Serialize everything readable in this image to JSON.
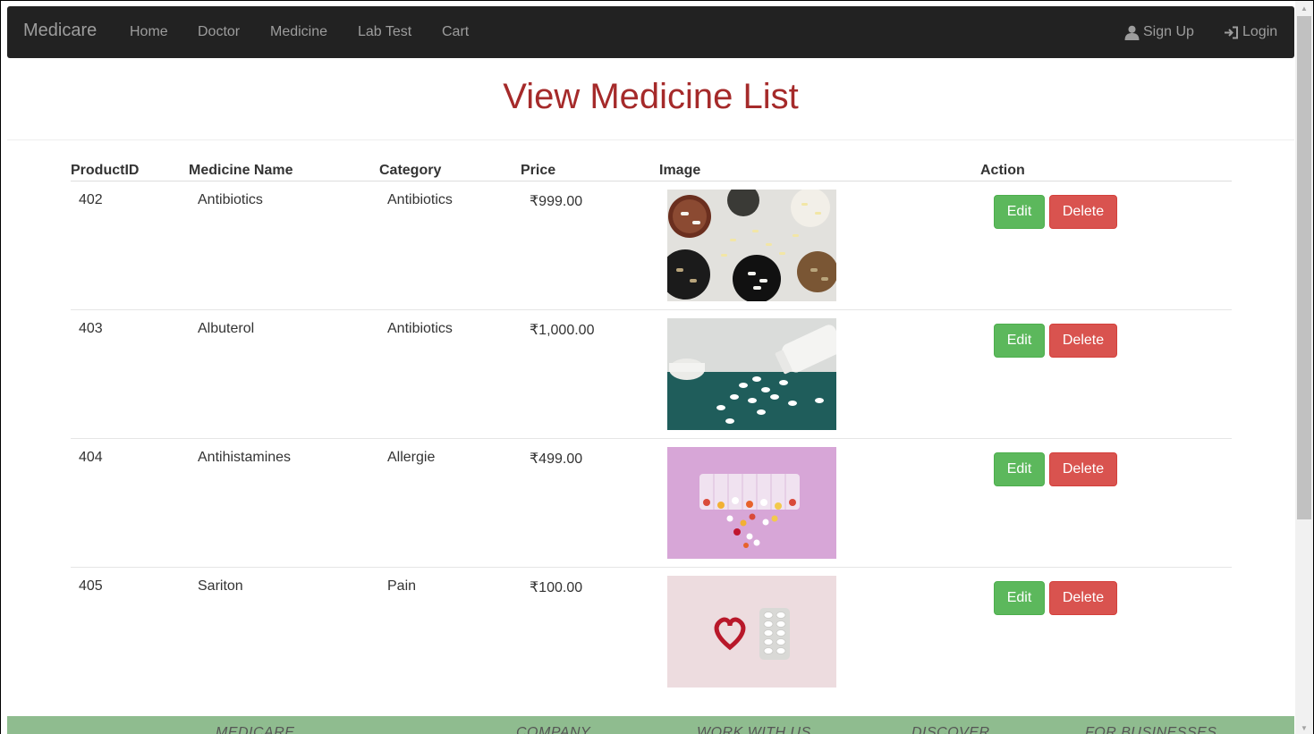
{
  "navbar": {
    "brand": "Medicare",
    "links": [
      "Home",
      "Doctor",
      "Medicine",
      "Lab Test",
      "Cart"
    ],
    "signup": "Sign Up",
    "login": "Login"
  },
  "page": {
    "title": "View Medicine List"
  },
  "table": {
    "headers": [
      "ProductID",
      "Medicine Name",
      "Category",
      "Price",
      "Image",
      "Action"
    ],
    "rows": [
      {
        "id": "402",
        "name": "Antibiotics",
        "category": "Antibiotics",
        "price": "₹999.00",
        "image": "pills-bowls-photo",
        "edit": "Edit",
        "delete": "Delete"
      },
      {
        "id": "403",
        "name": "Albuterol",
        "category": "Antibiotics",
        "price": "₹1,000.00",
        "image": "spilled-pills-bottle-photo",
        "edit": "Edit",
        "delete": "Delete"
      },
      {
        "id": "404",
        "name": "Antihistamines",
        "category": "Allergie",
        "price": "₹499.00",
        "image": "pill-organizer-photo",
        "edit": "Edit",
        "delete": "Delete"
      },
      {
        "id": "405",
        "name": "Sariton",
        "category": "Pain",
        "price": "₹100.00",
        "image": "heart-blister-photo",
        "edit": "Edit",
        "delete": "Delete"
      }
    ]
  },
  "footer": {
    "columns": [
      "MEDICARE",
      "COMPANY",
      "WORK WITH US",
      "DISCOVER",
      "FOR BUSINESSES"
    ]
  },
  "colors": {
    "navbar_bg": "#222222",
    "title": "#a52a2a",
    "edit_button": "#5cb85c",
    "delete_button": "#d9534f",
    "footer_bg": "#8fbc8f"
  }
}
